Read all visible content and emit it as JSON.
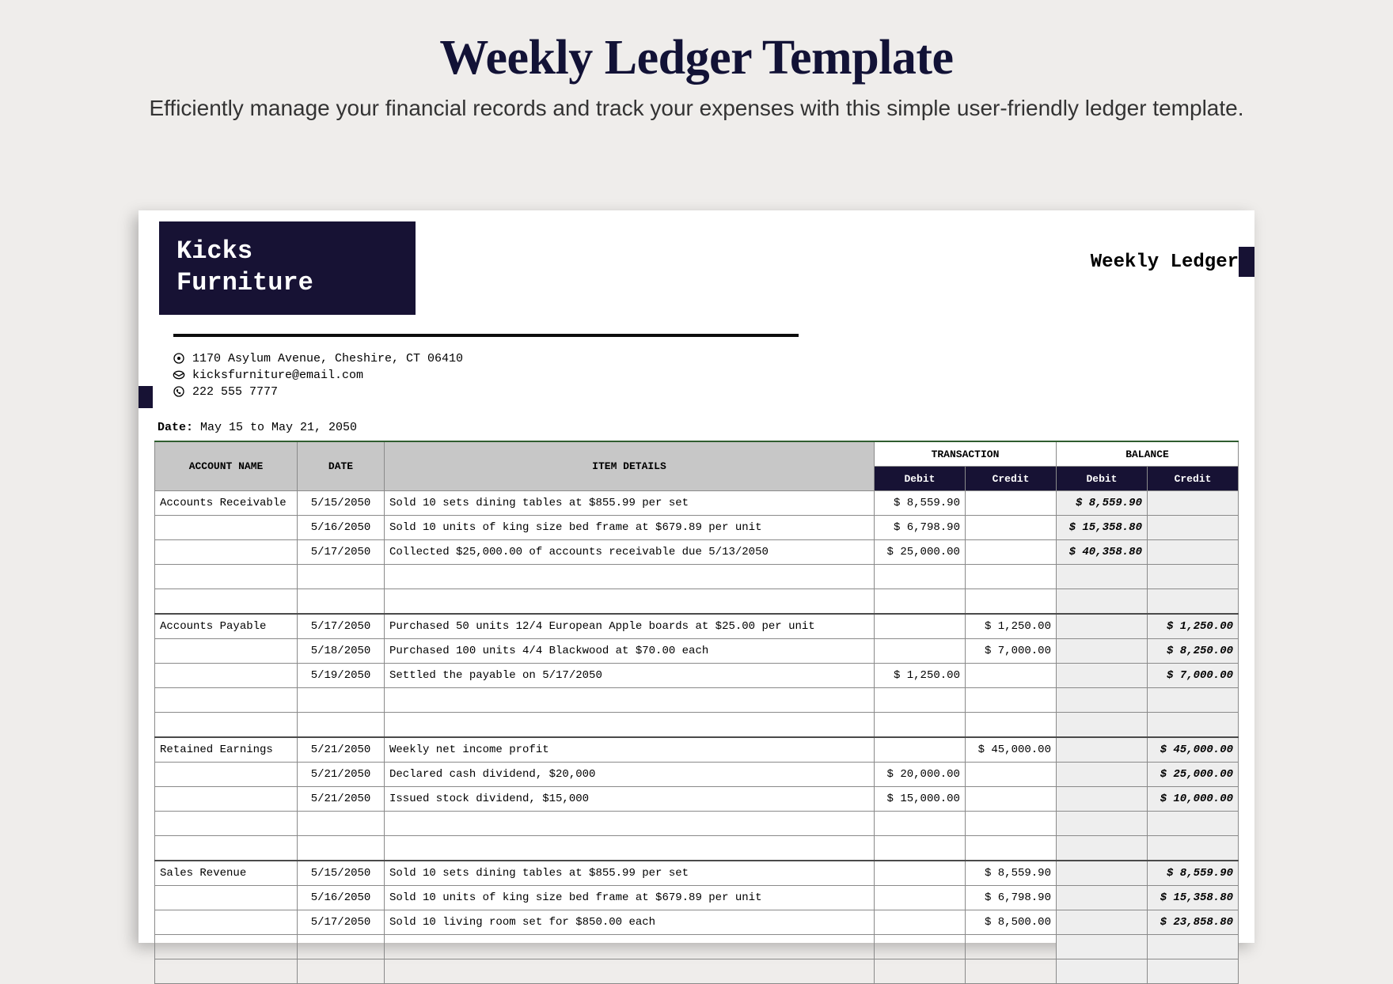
{
  "headline": "Weekly Ledger Template",
  "subhead": "Efficiently manage your financial records and track your expenses with this simple user-friendly ledger template.",
  "brand": {
    "line1": "Kicks",
    "line2": "Furniture"
  },
  "doc_title": "Weekly Ledger",
  "contact": {
    "address": "1170 Asylum Avenue, Cheshire, CT 06410",
    "email": "kicksfurniture@email.com",
    "phone": "222 555 7777"
  },
  "date_label": "Date:",
  "date_value": "May 15 to May 21, 2050",
  "columns": {
    "account": "ACCOUNT NAME",
    "date": "DATE",
    "details": "ITEM DETAILS",
    "transaction": "TRANSACTION",
    "balance": "BALANCE",
    "debit": "Debit",
    "credit": "Credit"
  },
  "sections": [
    {
      "account": "Accounts Receivable",
      "rows": [
        {
          "date": "5/15/2050",
          "details": "Sold 10 sets dining tables at $855.99 per set",
          "t_debit": "$   8,559.90",
          "t_credit": "",
          "b_debit": "$   8,559.90",
          "b_credit": ""
        },
        {
          "date": "5/16/2050",
          "details": "Sold 10 units of king size bed frame at $679.89 per unit",
          "t_debit": "$   6,798.90",
          "t_credit": "",
          "b_debit": "$  15,358.80",
          "b_credit": ""
        },
        {
          "date": "5/17/2050",
          "details": "Collected $25,000.00 of accounts receivable due 5/13/2050",
          "t_debit": "$  25,000.00",
          "t_credit": "",
          "b_debit": "$  40,358.80",
          "b_credit": ""
        }
      ]
    },
    {
      "account": "Accounts Payable",
      "rows": [
        {
          "date": "5/17/2050",
          "details": "Purchased 50 units 12/4 European Apple boards at $25.00 per unit",
          "t_debit": "",
          "t_credit": "$   1,250.00",
          "b_debit": "",
          "b_credit": "$   1,250.00"
        },
        {
          "date": "5/18/2050",
          "details": "Purchased 100 units 4/4 Blackwood at $70.00 each",
          "t_debit": "",
          "t_credit": "$   7,000.00",
          "b_debit": "",
          "b_credit": "$   8,250.00"
        },
        {
          "date": "5/19/2050",
          "details": "Settled the payable on 5/17/2050",
          "t_debit": "$   1,250.00",
          "t_credit": "",
          "b_debit": "",
          "b_credit": "$   7,000.00"
        }
      ]
    },
    {
      "account": "Retained Earnings",
      "rows": [
        {
          "date": "5/21/2050",
          "details": "Weekly net income profit",
          "t_debit": "",
          "t_credit": "$  45,000.00",
          "b_debit": "",
          "b_credit": "$  45,000.00"
        },
        {
          "date": "5/21/2050",
          "details": "Declared cash dividend, $20,000",
          "t_debit": "$  20,000.00",
          "t_credit": "",
          "b_debit": "",
          "b_credit": "$  25,000.00"
        },
        {
          "date": "5/21/2050",
          "details": "Issued stock dividend, $15,000",
          "t_debit": "$  15,000.00",
          "t_credit": "",
          "b_debit": "",
          "b_credit": "$  10,000.00"
        }
      ]
    },
    {
      "account": "Sales Revenue",
      "rows": [
        {
          "date": "5/15/2050",
          "details": "Sold 10 sets dining tables at $855.99 per set",
          "t_debit": "",
          "t_credit": "$   8,559.90",
          "b_debit": "",
          "b_credit": "$   8,559.90"
        },
        {
          "date": "5/16/2050",
          "details": "Sold 10 units of king size bed frame at $679.89 per unit",
          "t_debit": "",
          "t_credit": "$   6,798.90",
          "b_debit": "",
          "b_credit": "$  15,358.80"
        },
        {
          "date": "5/17/2050",
          "details": "Sold 10 living room set for $850.00 each",
          "t_debit": "",
          "t_credit": "$   8,500.00",
          "b_debit": "",
          "b_credit": "$  23,858.80"
        }
      ]
    }
  ]
}
